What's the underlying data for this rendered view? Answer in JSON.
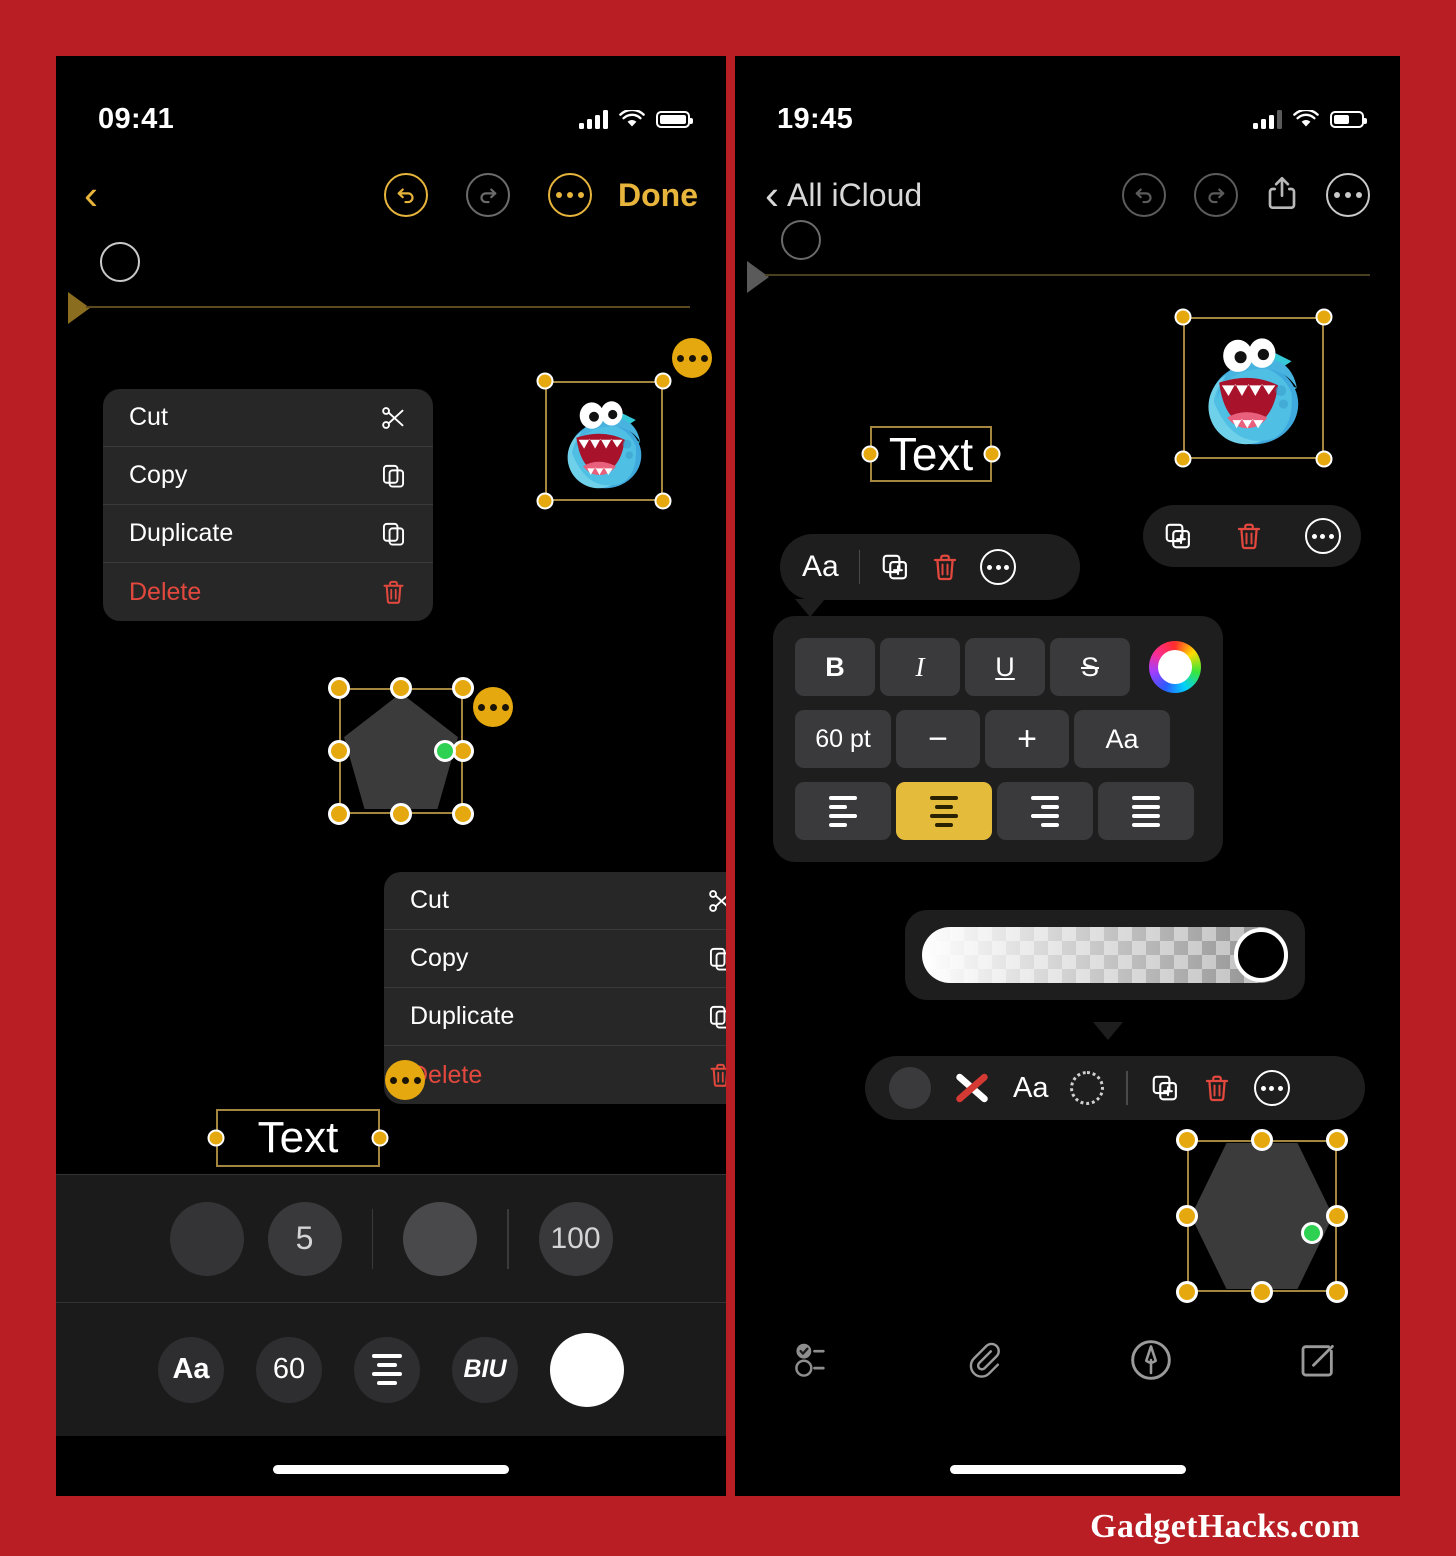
{
  "theme": {
    "background_red": "#b81e24",
    "accent_gold": "#e8b53c",
    "handle_orange": "#e5a90f",
    "selection_border": "#a4863f",
    "danger_red": "#e2483d",
    "green_dot": "#2fd152"
  },
  "left_phone": {
    "status": {
      "time": "09:41",
      "signal_icon": "cellular-bars-icon",
      "wifi_icon": "wifi-icon",
      "battery_icon": "battery-full-icon"
    },
    "nav": {
      "back_icon": "chevron-left-icon",
      "undo_icon": "undo-icon",
      "redo_icon": "redo-icon",
      "more_icon": "ellipsis-circle-icon",
      "done_label": "Done"
    },
    "context_menu_top": {
      "items": [
        {
          "label": "Cut",
          "icon": "scissors-icon"
        },
        {
          "label": "Copy",
          "icon": "copy-icon"
        },
        {
          "label": "Duplicate",
          "icon": "duplicate-icon"
        },
        {
          "label": "Delete",
          "icon": "trash-icon"
        }
      ]
    },
    "context_menu_bottom": {
      "items": [
        {
          "label": "Cut",
          "icon": "scissors-icon"
        },
        {
          "label": "Copy",
          "icon": "copy-icon"
        },
        {
          "label": "Duplicate",
          "icon": "duplicate-icon"
        },
        {
          "label": "Delete",
          "icon": "trash-icon"
        }
      ]
    },
    "objects": {
      "sticker_label": "monster-sticker",
      "pentagon_label": "pentagon-shape",
      "text_label": "Text"
    },
    "stroke_toolbar": {
      "color_swatch": "stroke-color-swatch",
      "width_value": "5",
      "fill_swatch": "fill-color-swatch",
      "opacity_value": "100"
    },
    "text_toolbar": {
      "font_label": "Aa",
      "size_label": "60",
      "align_icon": "align-center-icon",
      "style_label": "BIU",
      "color_swatch": "text-color-swatch"
    }
  },
  "right_phone": {
    "status": {
      "time": "19:45",
      "signal_icon": "cellular-bars-icon",
      "wifi_icon": "wifi-icon",
      "battery_icon": "battery-half-icon"
    },
    "nav": {
      "back_icon": "chevron-left-icon",
      "back_label": "All iCloud",
      "undo_icon": "undo-icon",
      "redo_icon": "redo-icon",
      "share_icon": "share-icon",
      "more_icon": "ellipsis-circle-icon"
    },
    "objects": {
      "sticker_label": "monster-sticker",
      "text_label": "Text",
      "hexagon_label": "hexagon-shape"
    },
    "sticker_toolbar": {
      "duplicate_icon": "duplicate-icon",
      "delete_icon": "trash-icon",
      "more_icon": "ellipsis-circle-icon"
    },
    "text_toolbar": {
      "font_label": "Aa",
      "duplicate_icon": "duplicate-icon",
      "delete_icon": "trash-icon",
      "more_icon": "ellipsis-circle-icon"
    },
    "format_panel": {
      "bold_label": "B",
      "italic_label": "I",
      "underline_label": "U",
      "strike_label": "S",
      "color_wheel_icon": "color-wheel-icon",
      "size_label": "60 pt",
      "decrease_label": "−",
      "increase_label": "+",
      "font_label": "Aa",
      "align_left_icon": "align-left-icon",
      "align_center_icon": "align-center-icon",
      "align_right_icon": "align-right-icon",
      "align_justify_icon": "align-justify-icon",
      "active_alignment": "center"
    },
    "opacity_slider": {
      "label": "opacity-slider",
      "knob_position_percent": "100"
    },
    "shape_toolbar": {
      "color_swatch": "shape-color-swatch",
      "no_fill_icon": "no-fill-x-icon",
      "font_label": "Aa",
      "dashed_circle_icon": "dashed-circle-icon",
      "duplicate_icon": "duplicate-icon",
      "delete_icon": "trash-icon",
      "more_icon": "ellipsis-circle-icon"
    },
    "tab_bar": {
      "items": [
        {
          "icon": "checklist-icon"
        },
        {
          "icon": "paperclip-icon"
        },
        {
          "icon": "markup-pen-icon"
        },
        {
          "icon": "compose-icon"
        }
      ]
    }
  },
  "watermark": {
    "text": "GadgetHacks.com"
  }
}
